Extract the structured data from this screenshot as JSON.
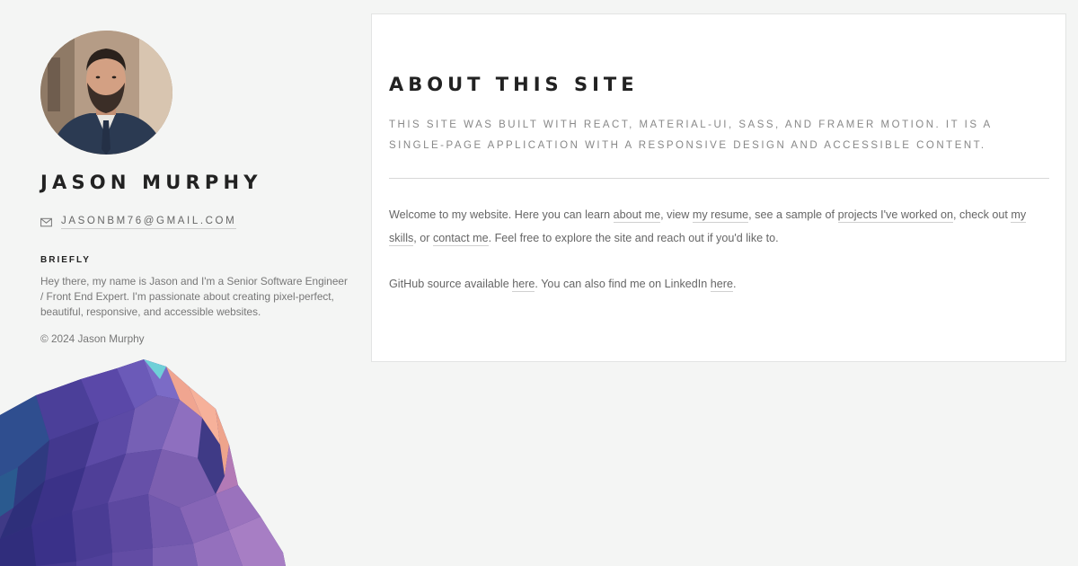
{
  "profile": {
    "name": "JASON MURPHY",
    "email": "JASONBM76@GMAIL.COM",
    "avatar_alt": "avatar"
  },
  "briefly": {
    "heading": "BRIEFLY",
    "text": "Hey there, my name is Jason and I'm a Senior Software Engineer / Front End Expert. I'm passionate about creating pixel-perfect, beautiful, responsive, and accessible websites."
  },
  "footer": {
    "copyright": "© 2024 Jason Murphy"
  },
  "about": {
    "title": "ABOUT THIS SITE",
    "subtitle": "THIS SITE WAS BUILT WITH REACT, MATERIAL-UI, SASS, AND FRAMER MOTION. IT IS A SINGLE-PAGE APPLICATION WITH A RESPONSIVE DESIGN AND ACCESSIBLE CONTENT.",
    "p1": {
      "t1": "Welcome to my website. Here you can learn ",
      "link_about": "about me",
      "t2": ", view ",
      "link_resume": "my resume",
      "t3": ", see a sample of ",
      "link_projects": "projects I've worked on",
      "t4": ", check out ",
      "link_skills": "my skills",
      "t5": ", or ",
      "link_contact": "contact me",
      "t6": ". Feel free to explore the site and reach out if you'd like to."
    },
    "p2": {
      "t1": "GitHub source available ",
      "link_github": "here",
      "t2": ". You can also find me on LinkedIn ",
      "link_linkedin": "here",
      "t3": "."
    }
  },
  "icons": {
    "mail": "mail-icon"
  }
}
